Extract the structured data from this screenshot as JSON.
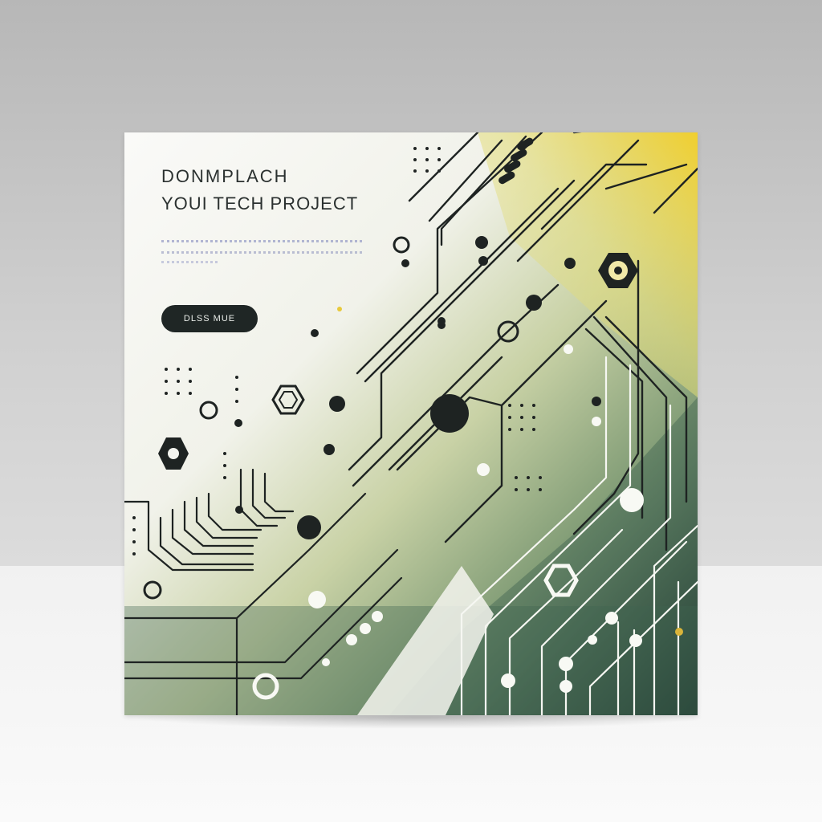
{
  "card": {
    "headline_line1": "DONMPLACH",
    "headline_line2": "YOUI TECH PROJECT",
    "button_label": "DLSS MUE"
  },
  "colors": {
    "accent_yellow": "#ecd23f",
    "accent_green": "#3f6350",
    "trace_dark": "#1e2322",
    "paper": "#fafaf7"
  }
}
